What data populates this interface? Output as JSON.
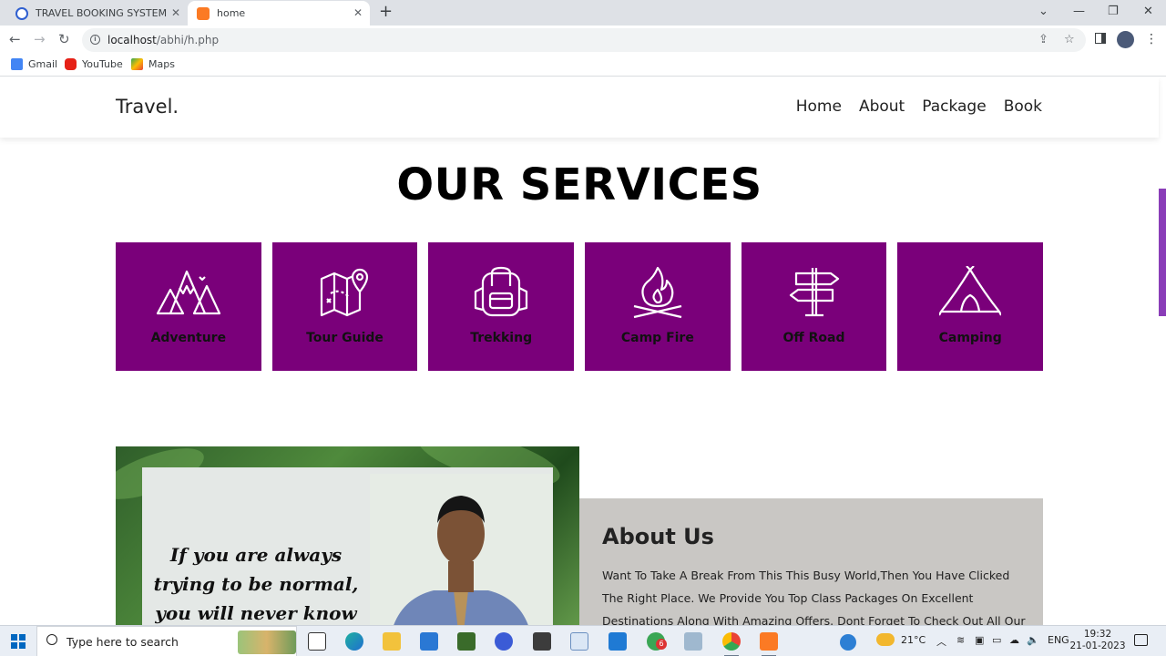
{
  "browser": {
    "tabs": [
      {
        "title": "TRAVEL BOOKING SYSTEM | Prezi",
        "active": false
      },
      {
        "title": "home",
        "active": true
      }
    ],
    "new_tab_symbol": "+",
    "url_host": "localhost",
    "url_path": "/abhi/h.php",
    "bookmarks": [
      {
        "label": "Gmail",
        "icon": "gmail-icon"
      },
      {
        "label": "YouTube",
        "icon": "youtube-icon"
      },
      {
        "label": "Maps",
        "icon": "maps-icon"
      }
    ]
  },
  "site": {
    "logo": "Travel.",
    "nav": [
      "Home",
      "About",
      "Package",
      "Book"
    ],
    "services_heading": "OUR SERVICES",
    "services": [
      {
        "label": "Adventure",
        "icon": "mountains-icon"
      },
      {
        "label": "Tour Guide",
        "icon": "map-pin-icon"
      },
      {
        "label": "Trekking",
        "icon": "backpack-icon"
      },
      {
        "label": "Camp Fire",
        "icon": "campfire-icon"
      },
      {
        "label": "Off Road",
        "icon": "signpost-icon"
      },
      {
        "label": "Camping",
        "icon": "tent-icon"
      }
    ],
    "colors": {
      "service_tile": "#7a007a",
      "about_box": "#c9c7c4",
      "scroll_thumb": "#8a3db8"
    },
    "about": {
      "poster_quote": "If you are always trying to be normal, you will never know",
      "title": "About Us",
      "text": "Want To Take A Break From This This Busy World,Then You Have Clicked The Right Place. We Provide You Top Class Packages On Excellent Destinations Along With Amazing Offers. Dont Forget To Check Out All Our"
    }
  },
  "taskbar": {
    "search_placeholder": "Type here to search",
    "weather": "21°C",
    "language": "ENG",
    "time": "19:32",
    "date": "21-01-2023",
    "mail_badge": "6"
  }
}
